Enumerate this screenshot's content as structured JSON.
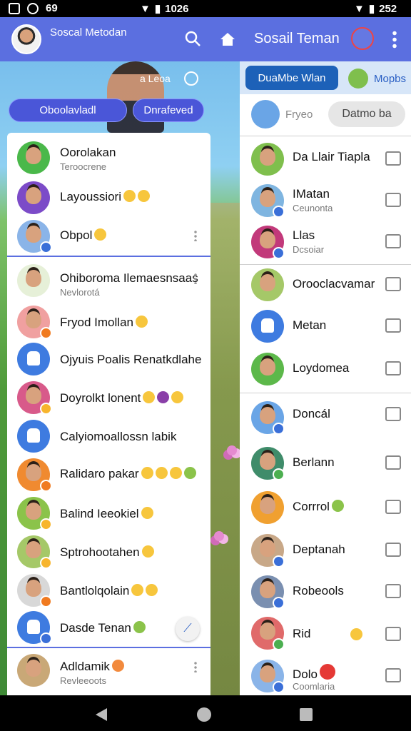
{
  "status_bar": {
    "time": "1026",
    "battery_right": "252",
    "left_icon_label": "69"
  },
  "left_panel": {
    "title": "Soscal Metodan",
    "hero_label": "a Leoa",
    "pill_left": "Oboolavladl",
    "pill_right": "Dnrafeved",
    "contacts": [
      {
        "name": "Oorolakan",
        "sub": "Teroocrene"
      },
      {
        "name": "Layoussiori",
        "sub": ""
      },
      {
        "name": "Obpol",
        "sub": ""
      },
      {
        "name": "Ohiboroma Ilemaesnsaas",
        "sub": "Nevlorotá"
      },
      {
        "name": "Fryod Imollan",
        "sub": ""
      },
      {
        "name": "Ojyuis Poalis Renatkdlahe",
        "sub": ""
      },
      {
        "name": "Doyrolkt lonent",
        "sub": ""
      },
      {
        "name": "Calyiomoallossn labik",
        "sub": ""
      },
      {
        "name": "Ralidaro pakar",
        "sub": ""
      },
      {
        "name": "Balind Ieeokiel",
        "sub": ""
      },
      {
        "name": "Sptrohootahen",
        "sub": ""
      },
      {
        "name": "Bantlolqolain",
        "sub": ""
      },
      {
        "name": "Dasde Tenan",
        "sub": ""
      },
      {
        "name": "Adldamik",
        "sub": "Revleeoots"
      }
    ]
  },
  "right_panel": {
    "title": "Sosail Teman",
    "tab_active": "DuaMbe Wlan",
    "tab_other": "Mopbs",
    "search_placeholder": "Fryeo",
    "search_button": "Datmo ba",
    "contacts": [
      {
        "name": "Da Llair Tiapla",
        "sub": ""
      },
      {
        "name": "IMatan",
        "sub": "Ceunonta"
      },
      {
        "name": "Llas",
        "sub": "Dcsoiar"
      },
      {
        "name": "Orooclacvamar",
        "sub": ""
      },
      {
        "name": "Metan",
        "sub": ""
      },
      {
        "name": "Loydomea",
        "sub": ""
      },
      {
        "name": "Doncál",
        "sub": ""
      },
      {
        "name": "Berlann",
        "sub": ""
      },
      {
        "name": "Corrrol",
        "sub": ""
      },
      {
        "name": "Deptanah",
        "sub": ""
      },
      {
        "name": "Robeools",
        "sub": ""
      },
      {
        "name": "Rid",
        "sub": ""
      },
      {
        "name": "Dolo",
        "sub": "Coomlaria"
      }
    ]
  },
  "colors": {
    "header": "#5b6fe0",
    "accent": "#1d61b8",
    "divider": "#5b6fe0"
  }
}
